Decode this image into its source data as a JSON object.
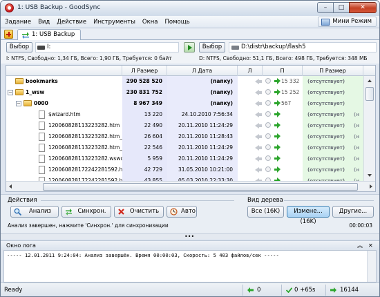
{
  "window": {
    "title": "1: USB Backup - GoodSync",
    "controls": {
      "minimize": "–",
      "maximize": "□",
      "close": "✕"
    }
  },
  "menu": {
    "items": [
      "Задание",
      "Вид",
      "Действие",
      "Инструменты",
      "Окна",
      "Помощь"
    ],
    "mini_mode": "Мини Режим"
  },
  "tabs": [
    {
      "label": "1: USB Backup"
    }
  ],
  "left_folder": {
    "browse_label": "Выбор",
    "path": "I:",
    "fs_info": "I: NTFS, Свободно: 1,34 ГБ, Всего: 1,90 ГБ, Требуется: 0 байт"
  },
  "right_folder": {
    "browse_label": "Выбор",
    "path": "D:\\distr\\backup\\flash5",
    "fs_info": "D: NTFS, Свободно: 51,1 ГБ, Всего: 498 ГБ, Требуется: 348 МБ"
  },
  "grid": {
    "columns": {
      "lsize": "Л Размер",
      "ldate": "Л Дата",
      "l": "Л",
      "p": "П",
      "psize": "П Размер"
    },
    "rows": [
      {
        "name": "bookmarks",
        "lsize": "290 528 520",
        "ldate": "(папку)",
        "count": "",
        "pstat": "(отсутствует)",
        "extra": "",
        "bold": true
      },
      {
        "name": "1_wsw",
        "lsize": "230 831 752",
        "ldate": "(папку)",
        "count": "15 252",
        "pstat": "(отсутствует)",
        "extra": "",
        "bold": true
      },
      {
        "name": "0000",
        "lsize": "8 967 349",
        "ldate": "(папку)",
        "count": "567",
        "pstat": "(отсутствует)",
        "extra": "",
        "bold": true
      },
      {
        "name": "$wizard.htm",
        "lsize": "13 220",
        "ldate": "24.10.2010 7:56:34",
        "count": "",
        "pstat": "(отсутствует)",
        "extra": "(н",
        "bold": false
      },
      {
        "name": "120060828113223282.htm",
        "lsize": "22 490",
        "ldate": "20.11.2010 11:24:29",
        "count": "",
        "pstat": "(отсутствует)",
        "extra": "(н",
        "bold": false
      },
      {
        "name": "120060828113223282.htm_c...",
        "lsize": "26 604",
        "ldate": "20.11.2010 11:28:43",
        "count": "",
        "pstat": "(отсутствует)",
        "extra": "(н",
        "bold": false
      },
      {
        "name": "120060828113223282.htm_o...",
        "lsize": "22 546",
        "ldate": "20.11.2010 11:24:29",
        "count": "",
        "pstat": "(отсутствует)",
        "extra": "(н",
        "bold": false
      },
      {
        "name": "120060828113223282.wswdb",
        "lsize": "5 959",
        "ldate": "20.11.2010 11:24:29",
        "count": "",
        "pstat": "(отсутствует)",
        "extra": "(н",
        "bold": false
      },
      {
        "name": "120060828172242281592.htm",
        "lsize": "42 729",
        "ldate": "31.05.2010 10:21:00",
        "count": "",
        "pstat": "(отсутствует)",
        "extra": "(н",
        "bold": false
      },
      {
        "name": "120060828172242281592.htm...",
        "lsize": "43 855",
        "ldate": "05.03.2010 22:33:30",
        "count": "",
        "pstat": "(отсутствует)",
        "extra": "(н",
        "bold": false
      }
    ],
    "first_row_count": "15 332"
  },
  "actions": {
    "group_label": "Действия",
    "analyze": "Анализ",
    "sync": "Синхрон.",
    "clear": "Очистить",
    "auto": "Авто",
    "status_message": "Анализ завершен, нажмите 'Синхрон.' для синхронизации",
    "elapsed": "00:00:03"
  },
  "tree_view": {
    "group_label": "Вид дерева",
    "all": "Все (16K)",
    "changed": "Измене... (16K)",
    "other": "Другие..."
  },
  "log": {
    "title": "Окно лога",
    "line": "----- 12.01.2011 9:24:04: Анализ завершён. Время 00:00:03, Скорость: 5 403 файлов/сек -----"
  },
  "status": {
    "ready": "Ready",
    "left_count": "0",
    "check_count": "0 +65s",
    "right_count": "16144"
  },
  "colors": {
    "accent_select": "#a9d2f4",
    "close_red": "#c44124",
    "left_col_bg": "#e6e8fa",
    "right_col_bg": "#e5f8e4",
    "copy_green": "#2ca52c"
  }
}
